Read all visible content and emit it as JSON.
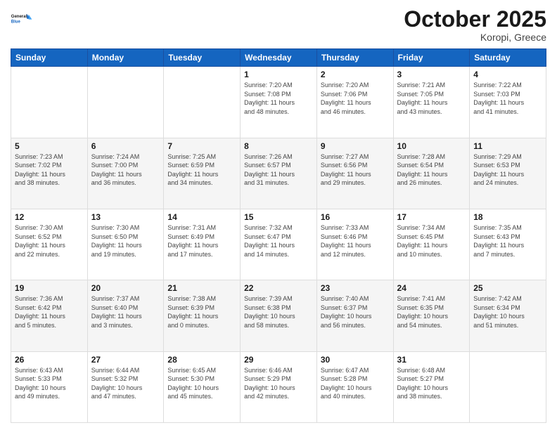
{
  "header": {
    "logo_line1": "General",
    "logo_line2": "Blue",
    "month_title": "October 2025",
    "location": "Koropi, Greece"
  },
  "weekdays": [
    "Sunday",
    "Monday",
    "Tuesday",
    "Wednesday",
    "Thursday",
    "Friday",
    "Saturday"
  ],
  "rows": [
    [
      {
        "day": "",
        "info": ""
      },
      {
        "day": "",
        "info": ""
      },
      {
        "day": "",
        "info": ""
      },
      {
        "day": "1",
        "info": "Sunrise: 7:20 AM\nSunset: 7:08 PM\nDaylight: 11 hours\nand 48 minutes."
      },
      {
        "day": "2",
        "info": "Sunrise: 7:20 AM\nSunset: 7:06 PM\nDaylight: 11 hours\nand 46 minutes."
      },
      {
        "day": "3",
        "info": "Sunrise: 7:21 AM\nSunset: 7:05 PM\nDaylight: 11 hours\nand 43 minutes."
      },
      {
        "day": "4",
        "info": "Sunrise: 7:22 AM\nSunset: 7:03 PM\nDaylight: 11 hours\nand 41 minutes."
      }
    ],
    [
      {
        "day": "5",
        "info": "Sunrise: 7:23 AM\nSunset: 7:02 PM\nDaylight: 11 hours\nand 38 minutes."
      },
      {
        "day": "6",
        "info": "Sunrise: 7:24 AM\nSunset: 7:00 PM\nDaylight: 11 hours\nand 36 minutes."
      },
      {
        "day": "7",
        "info": "Sunrise: 7:25 AM\nSunset: 6:59 PM\nDaylight: 11 hours\nand 34 minutes."
      },
      {
        "day": "8",
        "info": "Sunrise: 7:26 AM\nSunset: 6:57 PM\nDaylight: 11 hours\nand 31 minutes."
      },
      {
        "day": "9",
        "info": "Sunrise: 7:27 AM\nSunset: 6:56 PM\nDaylight: 11 hours\nand 29 minutes."
      },
      {
        "day": "10",
        "info": "Sunrise: 7:28 AM\nSunset: 6:54 PM\nDaylight: 11 hours\nand 26 minutes."
      },
      {
        "day": "11",
        "info": "Sunrise: 7:29 AM\nSunset: 6:53 PM\nDaylight: 11 hours\nand 24 minutes."
      }
    ],
    [
      {
        "day": "12",
        "info": "Sunrise: 7:30 AM\nSunset: 6:52 PM\nDaylight: 11 hours\nand 22 minutes."
      },
      {
        "day": "13",
        "info": "Sunrise: 7:30 AM\nSunset: 6:50 PM\nDaylight: 11 hours\nand 19 minutes."
      },
      {
        "day": "14",
        "info": "Sunrise: 7:31 AM\nSunset: 6:49 PM\nDaylight: 11 hours\nand 17 minutes."
      },
      {
        "day": "15",
        "info": "Sunrise: 7:32 AM\nSunset: 6:47 PM\nDaylight: 11 hours\nand 14 minutes."
      },
      {
        "day": "16",
        "info": "Sunrise: 7:33 AM\nSunset: 6:46 PM\nDaylight: 11 hours\nand 12 minutes."
      },
      {
        "day": "17",
        "info": "Sunrise: 7:34 AM\nSunset: 6:45 PM\nDaylight: 11 hours\nand 10 minutes."
      },
      {
        "day": "18",
        "info": "Sunrise: 7:35 AM\nSunset: 6:43 PM\nDaylight: 11 hours\nand 7 minutes."
      }
    ],
    [
      {
        "day": "19",
        "info": "Sunrise: 7:36 AM\nSunset: 6:42 PM\nDaylight: 11 hours\nand 5 minutes."
      },
      {
        "day": "20",
        "info": "Sunrise: 7:37 AM\nSunset: 6:40 PM\nDaylight: 11 hours\nand 3 minutes."
      },
      {
        "day": "21",
        "info": "Sunrise: 7:38 AM\nSunset: 6:39 PM\nDaylight: 11 hours\nand 0 minutes."
      },
      {
        "day": "22",
        "info": "Sunrise: 7:39 AM\nSunset: 6:38 PM\nDaylight: 10 hours\nand 58 minutes."
      },
      {
        "day": "23",
        "info": "Sunrise: 7:40 AM\nSunset: 6:37 PM\nDaylight: 10 hours\nand 56 minutes."
      },
      {
        "day": "24",
        "info": "Sunrise: 7:41 AM\nSunset: 6:35 PM\nDaylight: 10 hours\nand 54 minutes."
      },
      {
        "day": "25",
        "info": "Sunrise: 7:42 AM\nSunset: 6:34 PM\nDaylight: 10 hours\nand 51 minutes."
      }
    ],
    [
      {
        "day": "26",
        "info": "Sunrise: 6:43 AM\nSunset: 5:33 PM\nDaylight: 10 hours\nand 49 minutes."
      },
      {
        "day": "27",
        "info": "Sunrise: 6:44 AM\nSunset: 5:32 PM\nDaylight: 10 hours\nand 47 minutes."
      },
      {
        "day": "28",
        "info": "Sunrise: 6:45 AM\nSunset: 5:30 PM\nDaylight: 10 hours\nand 45 minutes."
      },
      {
        "day": "29",
        "info": "Sunrise: 6:46 AM\nSunset: 5:29 PM\nDaylight: 10 hours\nand 42 minutes."
      },
      {
        "day": "30",
        "info": "Sunrise: 6:47 AM\nSunset: 5:28 PM\nDaylight: 10 hours\nand 40 minutes."
      },
      {
        "day": "31",
        "info": "Sunrise: 6:48 AM\nSunset: 5:27 PM\nDaylight: 10 hours\nand 38 minutes."
      },
      {
        "day": "",
        "info": ""
      }
    ]
  ]
}
